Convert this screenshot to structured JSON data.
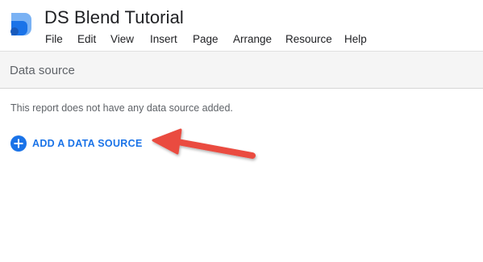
{
  "app": {
    "title": "DS Blend Tutorial",
    "logo_icon": "data-studio-logo-icon"
  },
  "menu": {
    "items": [
      {
        "label": "File"
      },
      {
        "label": "Edit"
      },
      {
        "label": "View"
      },
      {
        "label": "Insert"
      },
      {
        "label": "Page"
      },
      {
        "label": "Arrange"
      },
      {
        "label": "Resource"
      },
      {
        "label": "Help"
      }
    ]
  },
  "panel": {
    "header": "Data source",
    "empty_message": "This report does not have any data source added.",
    "add_button_label": "ADD A DATA SOURCE",
    "add_icon": "plus-circle-icon"
  },
  "annotation": {
    "arrow_icon": "pointer-arrow-icon",
    "arrow_color": "#ea4c3f"
  },
  "colors": {
    "accent": "#1a73e8",
    "logo_light": "#7ab2f4",
    "logo_dark": "#1a73e8"
  }
}
